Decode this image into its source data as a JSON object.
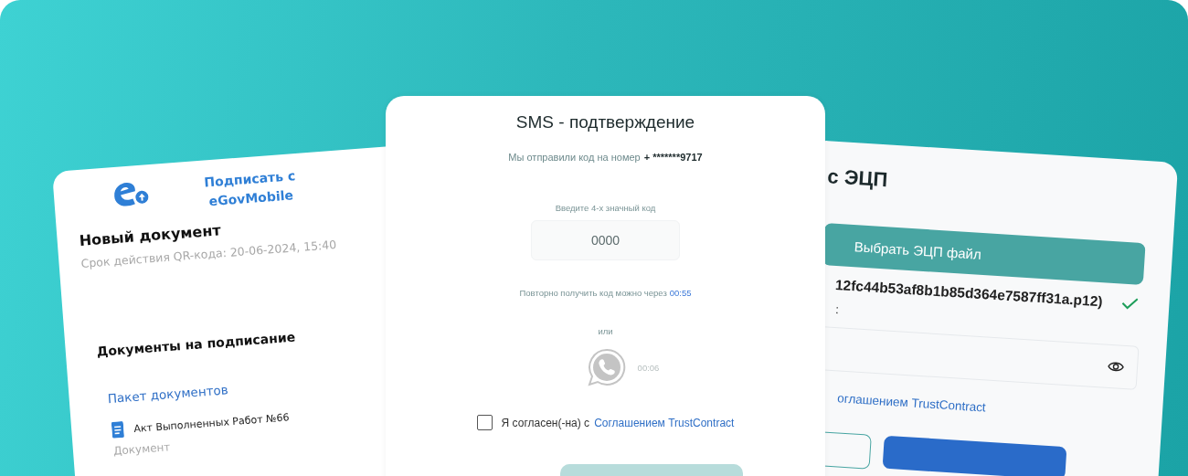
{
  "left_card": {
    "sign_link": "Подписать с eGovMobile",
    "title": "Новый документ",
    "qr_expiry": "Срок действия QR-кода: 20-06-2024, 15:40",
    "section_title": "Документы на подписание",
    "package_link": "Пакет документов",
    "documents": [
      {
        "name": "Акт Выполненных Работ №66",
        "type": "Документ"
      }
    ]
  },
  "sms_card": {
    "title": "SMS - подтверждение",
    "sent_text": "Мы отправили код на номер",
    "phone": "+ *******9717",
    "code_label": "Введите 4-х значный код",
    "code_placeholder": "0000",
    "resend_text": "Повторно получить код можно через",
    "resend_timer": "00:55",
    "or": "или",
    "whatsapp_timer": "00:06",
    "agree": {
      "checked": false,
      "text": "Я согласен(-на) с",
      "link": "Соглашением TrustContract"
    },
    "submit": {
      "disabled": true
    }
  },
  "ecp_card": {
    "title": "с ЭЦП",
    "choose_button": "Выбрать ЭЦП файл",
    "file_name": "12fc44b53af8b1b85d364e7587ff31a.p12)",
    "file_valid": true,
    "password_label": ":",
    "agree_link": "оглашением TrustContract"
  }
}
